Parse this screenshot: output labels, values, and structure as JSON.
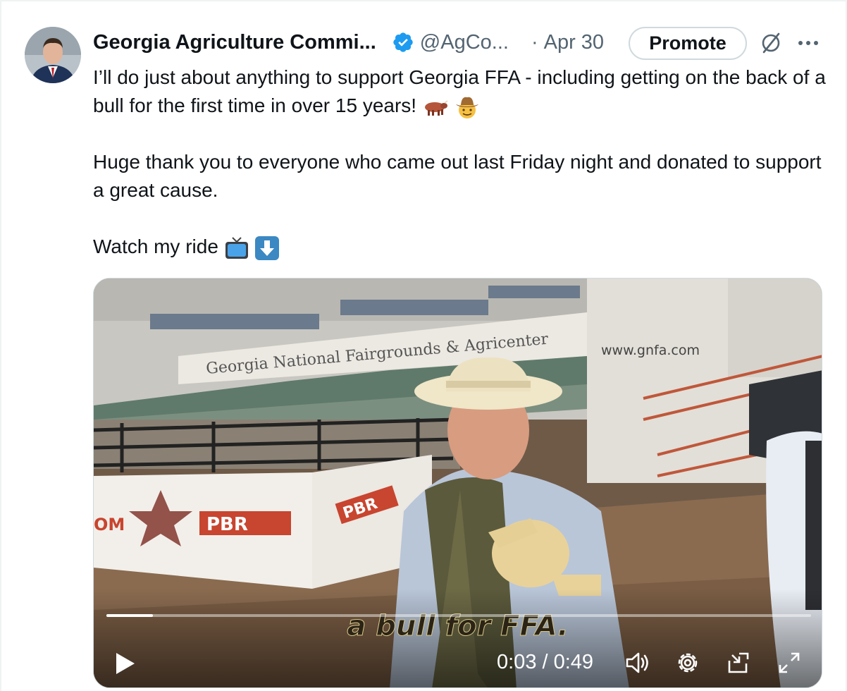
{
  "tweet": {
    "author_name": "Georgia Agriculture Commi...",
    "handle": "@AgCo...",
    "separator": "·",
    "date": "Apr 30",
    "promote_label": "Promote",
    "paragraphs": [
      "I’ll do just about anything to support Georgia FFA - including getting on the back of a bull for the first time in over 15 years!",
      "Huge thank you to everyone who came out last Friday night and donated to support a great cause.",
      "Watch my ride"
    ],
    "emojis": {
      "p1": [
        "ox-emoji",
        "cowboy-face-emoji"
      ],
      "p3": [
        "television-emoji",
        "down-arrow-emoji"
      ]
    }
  },
  "video": {
    "sign_text": "Georgia National Fairgrounds & Agricenter",
    "website_text": "www.gnfa.com",
    "banner_text": "PBR",
    "banner_edge_text": "OM",
    "caption": "a bull for FFA.",
    "time_display": "0:03 / 0:49",
    "progress_fraction": 0.066,
    "icons": [
      "play-icon",
      "volume-icon",
      "settings-icon",
      "popout-icon",
      "fullscreen-icon"
    ]
  },
  "colors": {
    "verified_blue": "#1d9bf0",
    "text_primary": "#0f1419",
    "text_secondary": "#536471",
    "border": "#cfd9de"
  }
}
